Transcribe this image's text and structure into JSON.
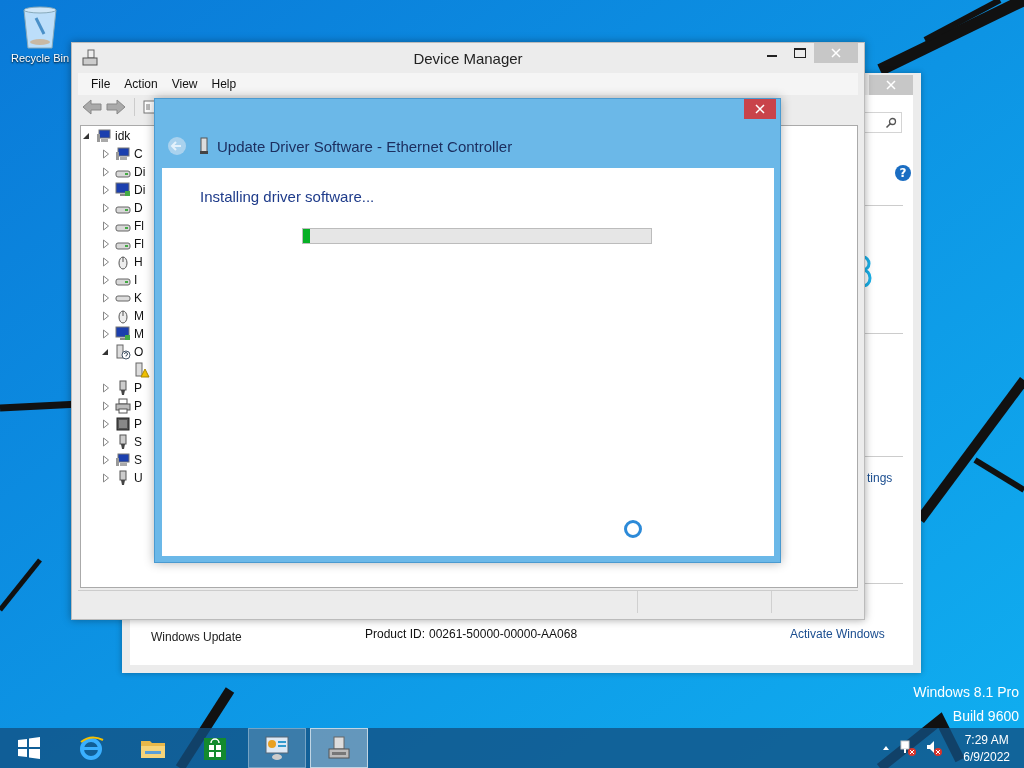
{
  "desktop": {
    "icons": [
      {
        "label": "Recycle Bin"
      }
    ],
    "edition": "Windows 8.1 Pro",
    "build": "Build 9600"
  },
  "system_window": {
    "help": "?",
    "link_partial": "tings",
    "windows_update": "Windows Update",
    "product_id_label": "Product ID:",
    "product_id": "00261-50000-00000-AA068",
    "activate": "Activate Windows"
  },
  "device_manager": {
    "title": "Device Manager",
    "menu": [
      "File",
      "Action",
      "View",
      "Help"
    ],
    "tree": {
      "label": "idk",
      "kind": "computer",
      "expanded": true,
      "children": [
        {
          "label": "C",
          "kind": "computer",
          "expanded": false
        },
        {
          "label": "Di",
          "kind": "drive",
          "expanded": false
        },
        {
          "label": "Di",
          "kind": "monitor",
          "expanded": false
        },
        {
          "label": "D",
          "kind": "drive",
          "expanded": false
        },
        {
          "label": "Fl",
          "kind": "drive",
          "expanded": false
        },
        {
          "label": "Fl",
          "kind": "drive",
          "expanded": false
        },
        {
          "label": "H",
          "kind": "mouse",
          "expanded": false
        },
        {
          "label": "I",
          "kind": "drive",
          "expanded": false
        },
        {
          "label": "K",
          "kind": "keyboard",
          "expanded": false
        },
        {
          "label": "M",
          "kind": "mouse",
          "expanded": false
        },
        {
          "label": "M",
          "kind": "monitor",
          "expanded": false
        },
        {
          "label": "O",
          "kind": "unknown",
          "expanded": true,
          "children": [
            {
              "kind": "warning"
            }
          ]
        },
        {
          "label": "P",
          "kind": "usb",
          "expanded": false
        },
        {
          "label": "P",
          "kind": "printer",
          "expanded": false
        },
        {
          "label": "P",
          "kind": "chip",
          "expanded": false
        },
        {
          "label": "S",
          "kind": "usb",
          "expanded": false
        },
        {
          "label": "S",
          "kind": "computer",
          "expanded": false
        },
        {
          "label": "U",
          "kind": "usb",
          "expanded": false
        }
      ]
    }
  },
  "dialog": {
    "title": "Update Driver Software - Ethernet Controller",
    "status": "Installing driver software...",
    "level": 0.02
  },
  "taskbar": {
    "apps": [
      {
        "kind": "start",
        "running": false,
        "selected": false
      },
      {
        "kind": "browser",
        "running": false,
        "selected": false
      },
      {
        "kind": "folder",
        "running": false,
        "selected": false
      },
      {
        "kind": "store",
        "running": false,
        "selected": false
      },
      {
        "kind": "control-panel",
        "running": true,
        "selected": false
      },
      {
        "kind": "device-manager",
        "running": true,
        "selected": true
      }
    ],
    "time": "7:29 AM",
    "date": "6/9/2022"
  }
}
